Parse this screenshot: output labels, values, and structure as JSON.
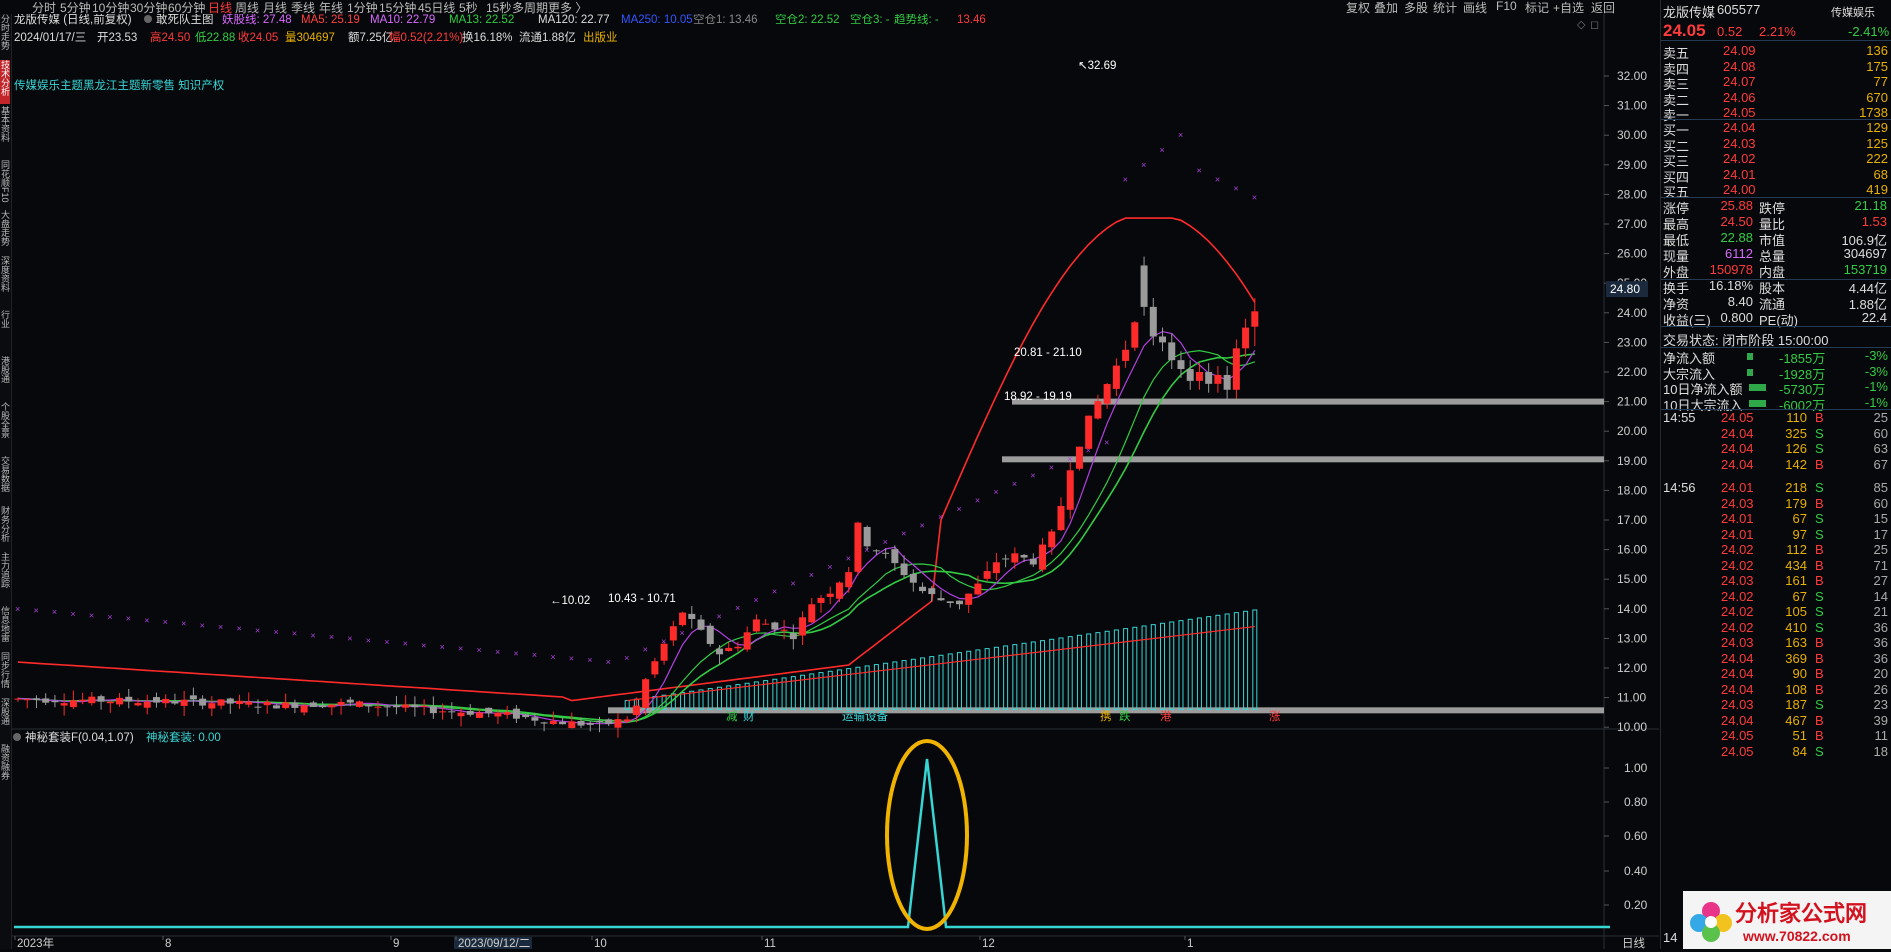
{
  "toolbar": {
    "period_tabs": [
      "分时",
      "5分钟",
      "10分钟",
      "30分钟",
      "60分钟",
      "日线",
      "周线",
      "月线",
      "季线",
      "年线",
      "1分钟",
      "15分钟",
      "45日线",
      "5秒",
      "15秒",
      "多周期",
      "更多 〉"
    ],
    "active_tab": "日线",
    "right_buttons": [
      "复权",
      "叠加",
      "多股",
      "统计",
      "画线",
      "F10",
      "标记",
      "+自选",
      "返回"
    ]
  },
  "left_sidebar": [
    "分时走势",
    "技术分析",
    "基本资料",
    "同花顺F10",
    "大盘走势",
    "深度资料",
    "行业",
    "港股通",
    "个股全景",
    "交易数据",
    "财务分析",
    "主力追踪",
    "信息地雷",
    "同步行情",
    "深股通",
    "融资融券"
  ],
  "main_chart": {
    "header_line1": {
      "stock": "龙版传媒 (日线,前复权)",
      "template": "敢死队主图",
      "indicators": [
        {
          "label": "妖股线: 27.48",
          "color": "#d86bff"
        },
        {
          "label": "MA5: 25.19",
          "color": "#ff4040"
        },
        {
          "label": "MA10: 22.79",
          "color": "#d86bff"
        },
        {
          "label": "MA13: 22.52",
          "color": "#33cc44"
        },
        {
          "label": "MA120: 22.77",
          "color": "#dddddd"
        },
        {
          "label": "MA250: 10.05",
          "color": "#3355ff"
        },
        {
          "label": "空仓1: 13.46",
          "color": "#888888"
        },
        {
          "label": "空仓2: 22.52",
          "color": "#33cc44"
        },
        {
          "label": "空仓3: -",
          "color": "#33cc44"
        },
        {
          "label": "趋势线: -",
          "color": "#33cc44"
        },
        {
          "label": "13.46",
          "color": "#ff3b3b"
        }
      ]
    },
    "header_line2": [
      {
        "label": "2024/01/17/三",
        "color": "#dddddd"
      },
      {
        "label": "开23.53",
        "color": "#dddddd"
      },
      {
        "label": "高24.50",
        "color": "#ff3b3b"
      },
      {
        "label": "低22.88",
        "color": "#33cc44"
      },
      {
        "label": "收24.05",
        "color": "#ff3b3b"
      },
      {
        "label": "量304697",
        "color": "#e8b000"
      },
      {
        "label": "额7.25亿",
        "color": "#dddddd"
      },
      {
        "label": "幅0.52(2.21%)",
        "color": "#ff3b3b"
      },
      {
        "label": "换16.18%",
        "color": "#dddddd"
      },
      {
        "label": "流通1.88亿",
        "color": "#dddddd"
      },
      {
        "label": "出版业",
        "color": "#e8b000"
      }
    ],
    "concepts": "传媒娱乐主题黑龙江主题新零售 知识产权",
    "price_axis": [
      "32.00",
      "31.00",
      "30.00",
      "29.00",
      "28.00",
      "27.00",
      "26.00",
      "25.00",
      "24.00",
      "23.00",
      "22.00",
      "21.00",
      "20.00",
      "19.00",
      "18.00",
      "17.00",
      "16.00",
      "15.00",
      "14.00",
      "13.00",
      "12.00",
      "11.00",
      "10.00"
    ],
    "current_price_tag": "24.80",
    "annotations": {
      "high": "32.69",
      "low": "10.02",
      "zone1": "20.81 - 21.10",
      "zone2": "18.92 - 19.19",
      "zone3": "10.43 - 10.71"
    },
    "event_labels": [
      {
        "label": "减",
        "color": "#33cc44"
      },
      {
        "label": "财",
        "color": "#38d5d5"
      },
      {
        "label": "运输设备",
        "color": "#38d5d5"
      },
      {
        "label": "携",
        "color": "#e8b000"
      },
      {
        "label": "跌",
        "color": "#33cc44"
      },
      {
        "label": "港",
        "color": "#ff3b3b"
      },
      {
        "label": "涨",
        "color": "#ff3b3b"
      }
    ]
  },
  "sub_chart": {
    "title": "神秘套装F(0.04,1.07)",
    "value_label": "神秘套装: 0.00",
    "axis": [
      "1.00",
      "0.80",
      "0.60",
      "0.40",
      "0.20"
    ]
  },
  "date_axis": {
    "labels": [
      "2023年",
      "8",
      "9",
      "2023/09/12/二",
      "10",
      "11",
      "12",
      "1"
    ],
    "right_label": "日线"
  },
  "right_panel": {
    "name": "龙版传媒",
    "code": "605577",
    "sector": "传媒娱乐",
    "price": "24.05",
    "change": "0.52",
    "change_pct": "2.21%",
    "sector_pct": "-2.41%",
    "asks": [
      {
        "label": "卖五",
        "price": "24.09",
        "vol": "136"
      },
      {
        "label": "卖四",
        "price": "24.08",
        "vol": "175"
      },
      {
        "label": "卖三",
        "price": "24.07",
        "vol": "77"
      },
      {
        "label": "卖二",
        "price": "24.06",
        "vol": "670"
      },
      {
        "label": "卖一",
        "price": "24.05",
        "vol": "1738"
      }
    ],
    "bids": [
      {
        "label": "买一",
        "price": "24.04",
        "vol": "129"
      },
      {
        "label": "买二",
        "price": "24.03",
        "vol": "125"
      },
      {
        "label": "买三",
        "price": "24.02",
        "vol": "222"
      },
      {
        "label": "买四",
        "price": "24.01",
        "vol": "68"
      },
      {
        "label": "买五",
        "price": "24.00",
        "vol": "419"
      }
    ],
    "stats": [
      [
        {
          "k": "涨停",
          "v": "25.88",
          "c": "red"
        },
        {
          "k": "跌停",
          "v": "21.18",
          "c": "green"
        }
      ],
      [
        {
          "k": "最高",
          "v": "24.50",
          "c": "red"
        },
        {
          "k": "量比",
          "v": "1.53",
          "c": "red"
        }
      ],
      [
        {
          "k": "最低",
          "v": "22.88",
          "c": "green"
        },
        {
          "k": "市值",
          "v": "106.9亿",
          "c": "white"
        }
      ],
      [
        {
          "k": "现量",
          "v": "6112",
          "c": "magenta"
        },
        {
          "k": "总量",
          "v": "304697",
          "c": "white"
        }
      ],
      [
        {
          "k": "外盘",
          "v": "150978",
          "c": "red"
        },
        {
          "k": "内盘",
          "v": "153719",
          "c": "green"
        }
      ],
      [
        {
          "k": "换手",
          "v": "16.18%",
          "c": "white"
        },
        {
          "k": "股本",
          "v": "4.44亿",
          "c": "white"
        }
      ],
      [
        {
          "k": "净资",
          "v": "8.40",
          "c": "white"
        },
        {
          "k": "流通",
          "v": "1.88亿",
          "c": "white"
        }
      ],
      [
        {
          "k": "收益(三)",
          "v": "0.800",
          "c": "white"
        },
        {
          "k": "PE(动)",
          "v": "22.4",
          "c": "white"
        }
      ]
    ],
    "trade_status": "交易状态: 闭市阶段 15:00:00",
    "flows": [
      {
        "k": "净流入额",
        "v": "-1855万",
        "p": "-3%",
        "bar": 0.15
      },
      {
        "k": "大宗流入",
        "v": "-1928万",
        "p": "-3%",
        "bar": 0.15
      },
      {
        "k": "10日净流入额",
        "v": "-5730万",
        "p": "-1%",
        "bar": 0.9
      },
      {
        "k": "10日大宗流入",
        "v": "-6002万",
        "p": "-1%",
        "bar": 0.9
      }
    ],
    "ticks": [
      {
        "time": "14:55",
        "price": "24.05",
        "vol": "110",
        "side": "B",
        "n": "25"
      },
      {
        "time": "",
        "price": "24.04",
        "vol": "325",
        "side": "S",
        "n": "60"
      },
      {
        "time": "",
        "price": "24.04",
        "vol": "126",
        "side": "S",
        "n": "63"
      },
      {
        "time": "",
        "price": "24.04",
        "vol": "142",
        "side": "B",
        "n": "67"
      },
      {
        "time": "14:56",
        "price": "24.01",
        "vol": "218",
        "side": "S",
        "n": "85"
      },
      {
        "time": "",
        "price": "24.03",
        "vol": "179",
        "side": "B",
        "n": "60"
      },
      {
        "time": "",
        "price": "24.01",
        "vol": "67",
        "side": "S",
        "n": "15"
      },
      {
        "time": "",
        "price": "24.01",
        "vol": "97",
        "side": "S",
        "n": "17"
      },
      {
        "time": "",
        "price": "24.02",
        "vol": "112",
        "side": "B",
        "n": "25"
      },
      {
        "time": "",
        "price": "24.02",
        "vol": "434",
        "side": "B",
        "n": "71"
      },
      {
        "time": "",
        "price": "24.03",
        "vol": "161",
        "side": "B",
        "n": "27"
      },
      {
        "time": "",
        "price": "24.02",
        "vol": "67",
        "side": "S",
        "n": "14"
      },
      {
        "time": "",
        "price": "24.02",
        "vol": "105",
        "side": "S",
        "n": "21"
      },
      {
        "time": "",
        "price": "24.02",
        "vol": "410",
        "side": "S",
        "n": "36"
      },
      {
        "time": "",
        "price": "24.03",
        "vol": "163",
        "side": "B",
        "n": "36"
      },
      {
        "time": "",
        "price": "24.04",
        "vol": "369",
        "side": "B",
        "n": "36"
      },
      {
        "time": "",
        "price": "24.04",
        "vol": "90",
        "side": "B",
        "n": "20"
      },
      {
        "time": "",
        "price": "24.04",
        "vol": "108",
        "side": "B",
        "n": "26"
      },
      {
        "time": "",
        "price": "24.03",
        "vol": "187",
        "side": "S",
        "n": "23"
      },
      {
        "time": "",
        "price": "24.04",
        "vol": "467",
        "side": "B",
        "n": "39"
      },
      {
        "time": "",
        "price": "24.05",
        "vol": "51",
        "side": "B",
        "n": "11"
      },
      {
        "time": "",
        "price": "24.05",
        "vol": "84",
        "side": "S",
        "n": "18"
      }
    ],
    "bottom_time": "14"
  },
  "watermark": {
    "title": "分析家公式网",
    "url": "www.70822.com"
  },
  "colors": {
    "up": "#ff2a2a",
    "down": "#9a9a9a",
    "ma5": "#ff2a2a",
    "ma10": "#b040e0",
    "ma13": "#33cc44",
    "cyan": "#38d5d5",
    "highlight": "#f0b400"
  }
}
